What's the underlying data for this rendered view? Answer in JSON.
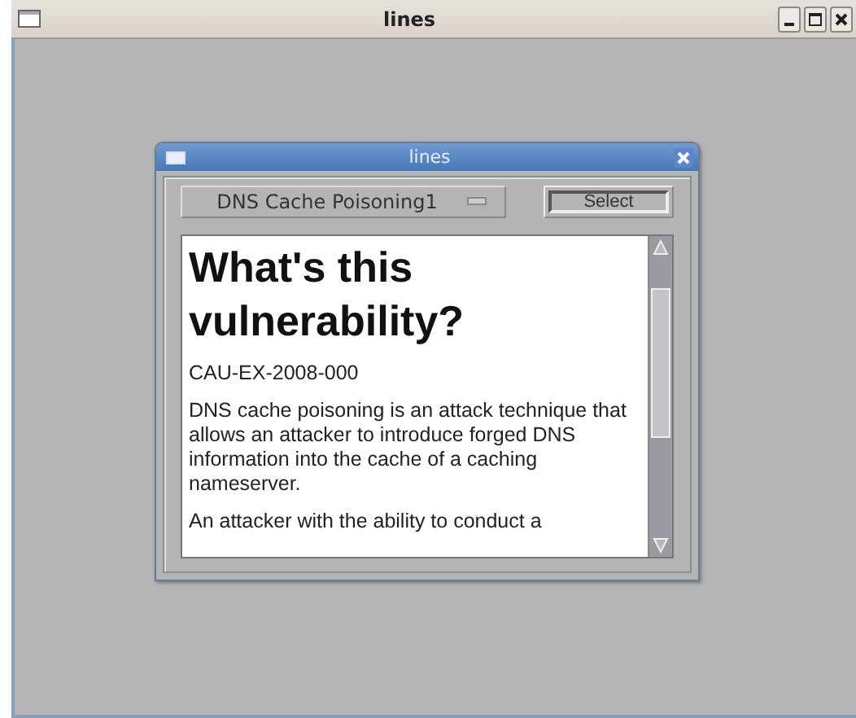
{
  "window": {
    "title": "lines"
  },
  "dialog": {
    "title": "lines",
    "dropdown": {
      "value": "DNS Cache Poisoning1"
    },
    "select_button": "Select",
    "content": {
      "heading": "What's this vulnerability?",
      "id": "CAU-EX-2008-000",
      "paragraphs": [
        "DNS cache poisoning is an attack technique that allows an attacker to introduce forged DNS information into the cache of a caching nameserver.",
        "An attacker with the ability to conduct a"
      ]
    }
  }
}
